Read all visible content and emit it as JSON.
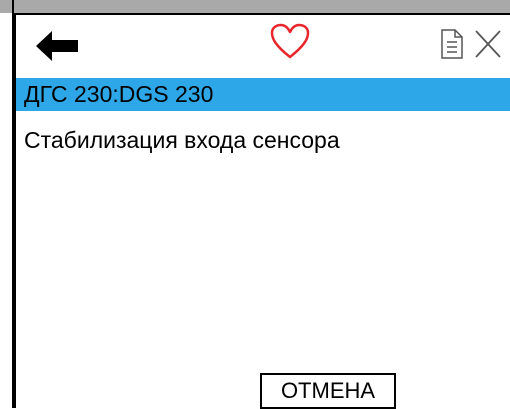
{
  "toolbar": {
    "back_icon": "arrow-left-icon",
    "favorite_icon": "heart-icon",
    "favorite_color": "#e8262b",
    "document_icon": "document-icon",
    "close_icon": "close-icon"
  },
  "title_bar": {
    "text": "ДГС 230:DGS 230",
    "background": "#2ea7e8"
  },
  "message": {
    "text": "Стабилизация входа сенсора"
  },
  "buttons": {
    "cancel_label": "ОТМЕНА"
  }
}
